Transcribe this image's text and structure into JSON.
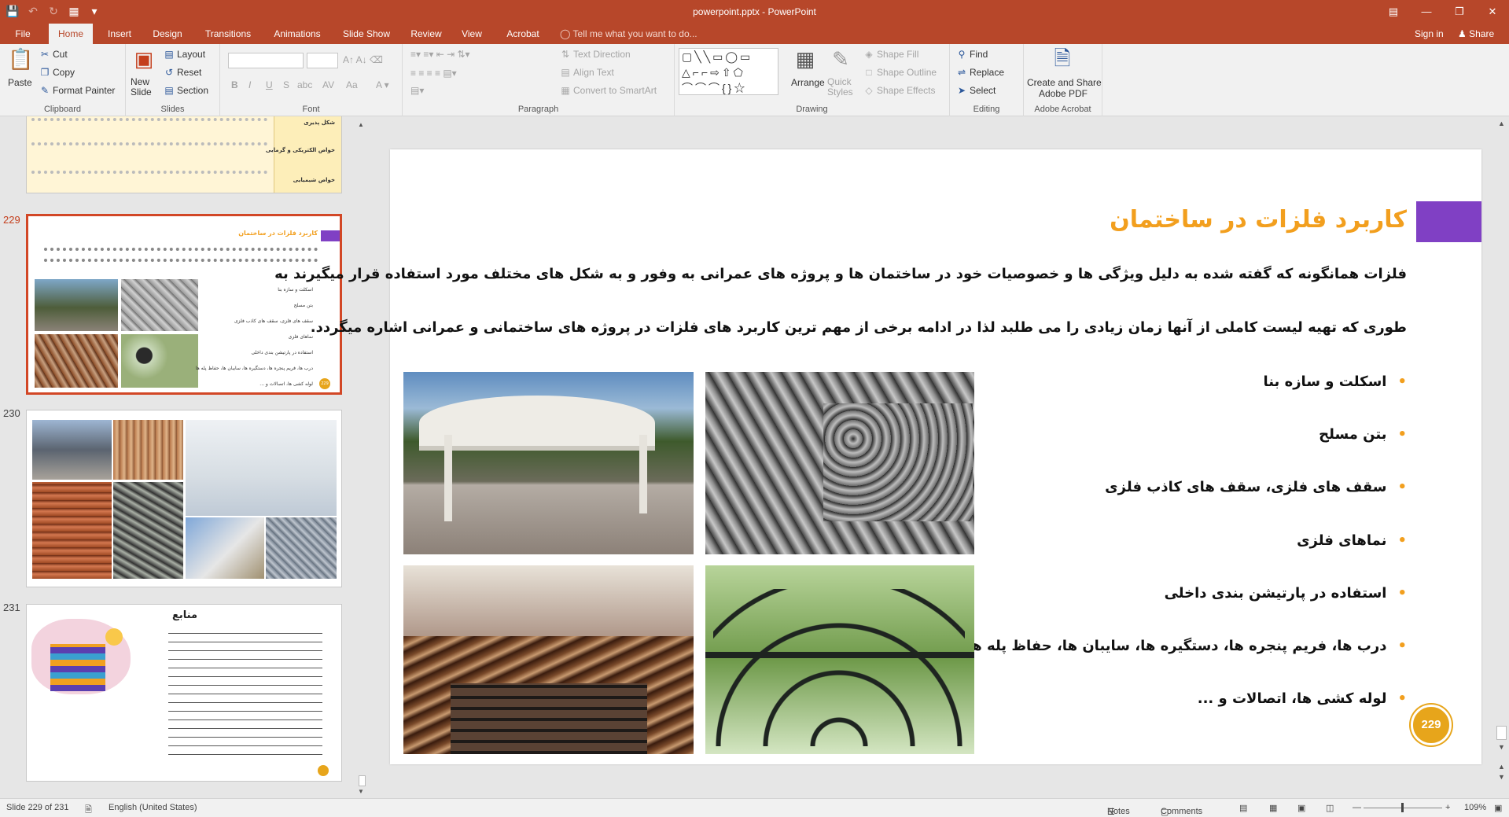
{
  "window": {
    "title": "powerpoint.pptx - PowerPoint"
  },
  "qat": {
    "save_icon": "save-icon",
    "undo_icon": "undo-icon",
    "redo_icon": "redo-icon",
    "present_icon": "present-icon"
  },
  "tabs": [
    "File",
    "Home",
    "Insert",
    "Design",
    "Transitions",
    "Animations",
    "Slide Show",
    "Review",
    "View",
    "Acrobat"
  ],
  "tell_me": "Tell me what you want to do...",
  "sign_in": "Sign in",
  "share": "Share",
  "ribbon": {
    "clipboard": {
      "label": "Clipboard",
      "paste": "Paste",
      "cut": "Cut",
      "copy": "Copy",
      "format_painter": "Format Painter"
    },
    "slides": {
      "label": "Slides",
      "new_slide": "New Slide",
      "layout": "Layout",
      "reset": "Reset",
      "section": "Section"
    },
    "font": {
      "label": "Font",
      "bold": "B",
      "italic": "I",
      "underline": "U",
      "strike": "S",
      "shadow": "abc",
      "spacing": "AV",
      "case": "Aa"
    },
    "paragraph": {
      "label": "Paragraph",
      "text_direction": "Text Direction",
      "align_text": "Align Text",
      "convert_smartart": "Convert to SmartArt"
    },
    "drawing": {
      "label": "Drawing",
      "arrange": "Arrange",
      "quick_styles": "Quick Styles",
      "shape_fill": "Shape Fill",
      "shape_outline": "Shape Outline",
      "shape_effects": "Shape Effects"
    },
    "editing": {
      "label": "Editing",
      "find": "Find",
      "replace": "Replace",
      "select": "Select"
    },
    "acrobat": {
      "label": "Adobe Acrobat",
      "create_share": "Create and Share",
      "adobe_pdf": "Adobe PDF"
    }
  },
  "thumbnails": [
    {
      "number": "229",
      "title": "کاربرد فلزات در ساختمان",
      "badge": "229",
      "bullets": [
        "اسکلت و سازه بنا",
        "بتن مسلح",
        "سقف های فلزی، سقف های کاذب فلزی",
        "نماهای فلزی",
        "استفاده در پارتیشن بندی داخلی",
        "درب ها، فریم پنجره ها، دستگیره ها، سایبان ها، حفاظ پله ها",
        "لوله کشی ها، اتصالات و ..."
      ]
    },
    {
      "number": "230"
    },
    {
      "number": "231",
      "title": "منابع"
    }
  ],
  "prev_thumbnail": {
    "rows": [
      "شکل پذیری",
      "خواص الکتریکی و گرمایی",
      "خواص شیمیایی"
    ]
  },
  "slide": {
    "title": "کاربرد فلزات در ساختمان",
    "paragraph_line1": "فلزات همانگونه که گفته شده به دلیل ویژگی ها و خصوصیات خود در ساختمان ها و پروژه های عمرانی به وفور و به شکل های مختلف مورد استفاده قرار میگیرند به",
    "paragraph_line2": "طوری که تهیه لیست کاملی از آنها زمان زیادی را می طلبد لذا در ادامه برخی از  مهم ترین کاربرد های فلزات در پروژه های ساختمانی و عمرانی اشاره میگردد.",
    "bullets": [
      "اسکلت و سازه بنا",
      "بتن مسلح",
      "سقف های فلزی، سقف های کاذب فلزی",
      "نماهای فلزی",
      "استفاده در پارتیشن بندی داخلی",
      "درب ها، فریم پنجره ها، دستگیره ها، سایبان ها، حفاظ پله ها",
      "لوله کشی ها، اتصالات و ..."
    ],
    "badge": "229",
    "colors": {
      "title": "#f29f1e",
      "accent_bar": "#8040c4",
      "badge": "#e7a51b"
    }
  },
  "status": {
    "slide_info": "Slide 229 of 231",
    "language": "English (United States)",
    "notes": "Notes",
    "comments": "Comments",
    "zoom": "109%"
  }
}
